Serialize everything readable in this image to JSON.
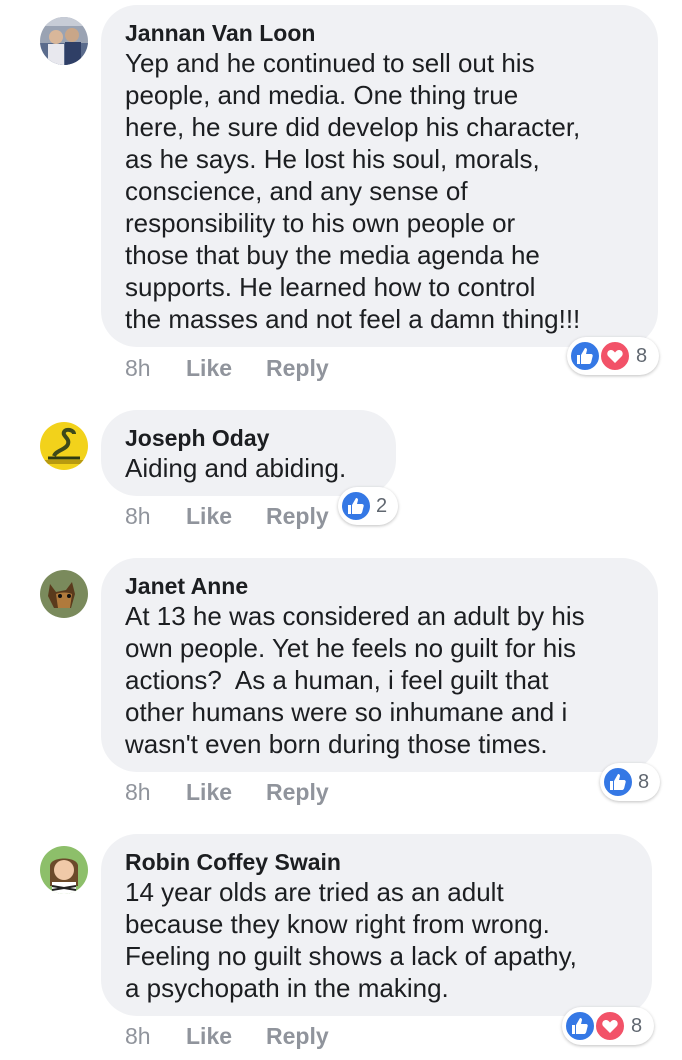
{
  "comments": [
    {
      "author": "Jannan Van Loon",
      "text": "Yep and he continued to sell out his\npeople, and media. One thing true\nhere, he sure did develop his character,\nas he says. He lost his soul, morals,\nconscience, and any sense of\nresponsibility to his own people or\nthose that buy the media agenda he\nsupports. He learned how to control\nthe masses and not feel a damn thing!!!",
      "time": "8h",
      "like": "Like",
      "reply": "Reply",
      "reaction_count": "8",
      "reactions": [
        "like",
        "love"
      ]
    },
    {
      "author": "Joseph Oday",
      "text": "Aiding and abiding.",
      "time": "8h",
      "like": "Like",
      "reply": "Reply",
      "reaction_count": "2",
      "reactions": [
        "like"
      ]
    },
    {
      "author": "Janet Anne",
      "text": "At 13 he was considered an adult by his\nown people. Yet he feels no guilt for his\nactions?  As a human, i feel guilt that\nother humans were so inhumane and i\nwasn't even born during those times.",
      "time": "8h",
      "like": "Like",
      "reply": "Reply",
      "reaction_count": "8",
      "reactions": [
        "like"
      ]
    },
    {
      "author": "Robin Coffey Swain",
      "text": "14 year olds are tried as an adult\nbecause they know right from wrong.\nFeeling no guilt shows a lack of apathy,\na psychopath in the making.",
      "time": "8h",
      "like": "Like",
      "reply": "Reply",
      "reaction_count": "8",
      "reactions": [
        "like",
        "love"
      ]
    }
  ],
  "colors": {
    "bubble": "#f0f1f4",
    "meta_text": "#90949c",
    "like_reaction": "#3578e5",
    "love_reaction": "#f25268"
  },
  "icons": {
    "like": "thumbs-up-icon",
    "love": "heart-icon"
  }
}
